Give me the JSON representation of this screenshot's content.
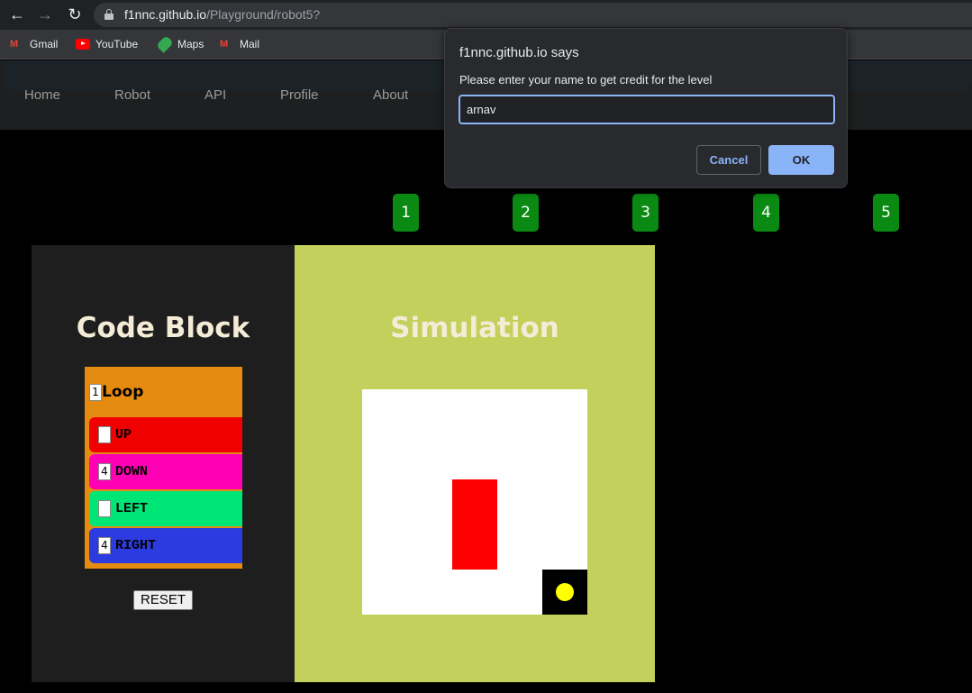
{
  "browser": {
    "url_host": "f1nnc.github.io",
    "url_path": "/Playground/robot5?",
    "bookmarks": [
      "Gmail",
      "YouTube",
      "Maps",
      "Mail"
    ]
  },
  "site": {
    "nav": [
      "Home",
      "Robot",
      "API",
      "Profile",
      "About"
    ],
    "levels": [
      "1",
      "2",
      "3",
      "4",
      "5"
    ],
    "code_title": "Code Block",
    "sim_title": "Simulation",
    "loop": {
      "label": "Loop",
      "count": "1"
    },
    "commands": [
      {
        "label": "UP",
        "value": "",
        "color": "#f00000"
      },
      {
        "label": "DOWN",
        "value": "4",
        "color": "#ff00b4"
      },
      {
        "label": "LEFT",
        "value": "",
        "color": "#00e676"
      },
      {
        "label": "RIGHT",
        "value": "4",
        "color": "#2c3be0"
      }
    ],
    "reset_label": "RESET",
    "colors": {
      "obstacle": "#ff0000",
      "robot": "#ffff00",
      "level_button": "#0b8a13"
    }
  },
  "dialog": {
    "title": "f1nnc.github.io says",
    "message": "Please enter your name to get credit for the level",
    "input_value": "arnav",
    "cancel_label": "Cancel",
    "ok_label": "OK"
  }
}
